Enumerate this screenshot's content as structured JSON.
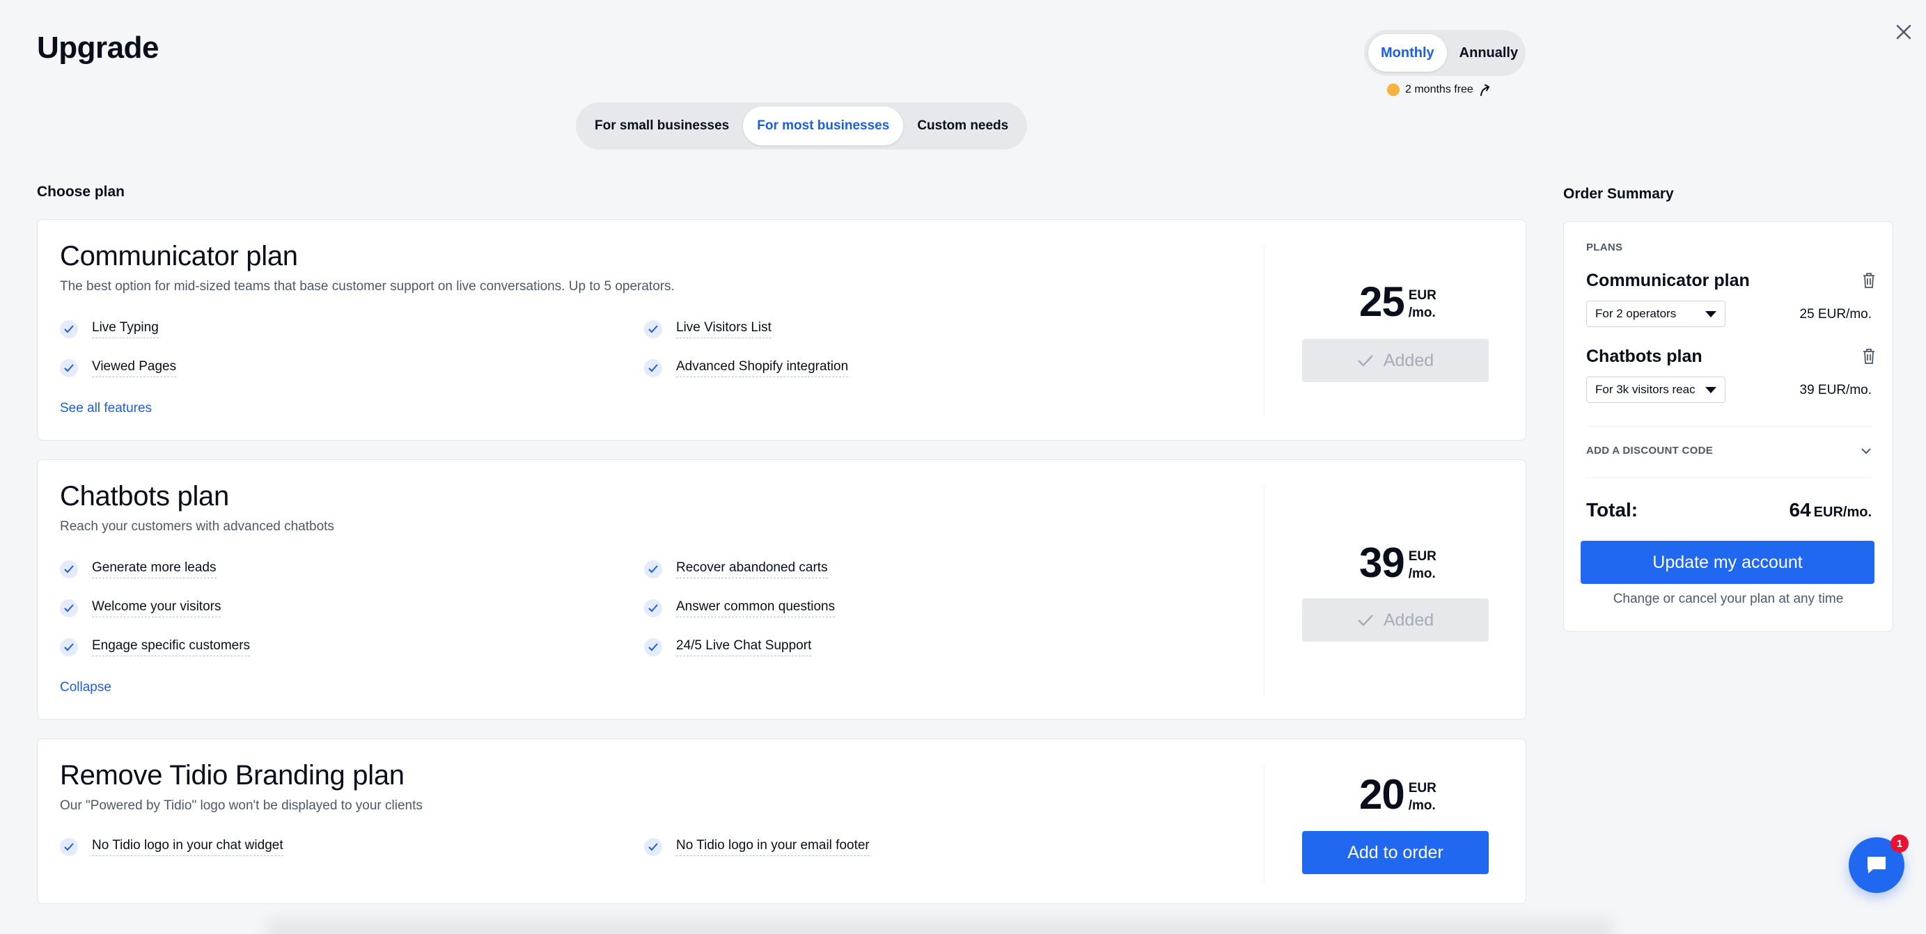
{
  "header": {
    "title": "Upgrade",
    "billing": {
      "options": [
        "Monthly",
        "Annually"
      ],
      "active": "Monthly"
    },
    "promo": "2 months free"
  },
  "segments": {
    "options": [
      "For small businesses",
      "For most businesses",
      "Custom needs"
    ],
    "active": "For most businesses"
  },
  "choose_label": "Choose plan",
  "plans": [
    {
      "name": "Communicator plan",
      "description": "The best option for mid-sized teams that base customer support on live conversations. Up to 5 operators.",
      "features": [
        "Live Typing",
        "Live Visitors List",
        "Viewed Pages",
        "Advanced Shopify integration"
      ],
      "link": "See all features",
      "price": "25",
      "currency": "EUR",
      "period": "/mo.",
      "button": "Added"
    },
    {
      "name": "Chatbots plan",
      "description": "Reach your customers with advanced chatbots",
      "features": [
        "Generate more leads",
        "Recover abandoned carts",
        "Welcome your visitors",
        "Answer common questions",
        "Engage specific customers",
        "24/5 Live Chat Support"
      ],
      "link": "Collapse",
      "price": "39",
      "currency": "EUR",
      "period": "/mo.",
      "button": "Added"
    },
    {
      "name": "Remove Tidio Branding plan",
      "description": "Our \"Powered by Tidio\" logo won't be displayed to your clients",
      "features": [
        "No Tidio logo in your chat widget",
        "No Tidio logo in your email footer"
      ],
      "price": "20",
      "currency": "EUR",
      "period": "/mo.",
      "button": "Add to order"
    }
  ],
  "summary": {
    "title": "Order Summary",
    "plans_label": "PLANS",
    "items": [
      {
        "name": "Communicator plan",
        "select": "For 2 operators",
        "price": "25",
        "unit": "EUR/mo."
      },
      {
        "name": "Chatbots plan",
        "select": "For 3k visitors reac",
        "price": "39",
        "unit": "EUR/mo."
      }
    ],
    "discount": "ADD A DISCOUNT CODE",
    "total_label": "Total:",
    "total": "64",
    "total_unit": "EUR/mo.",
    "update_button": "Update my account",
    "note": "Change or cancel your plan at any time"
  },
  "chat_badge": "1",
  "colors": {
    "accent": "#2168f0",
    "link": "#1d5ddf",
    "badge": "#e81332",
    "background": "#f5f6f8"
  }
}
